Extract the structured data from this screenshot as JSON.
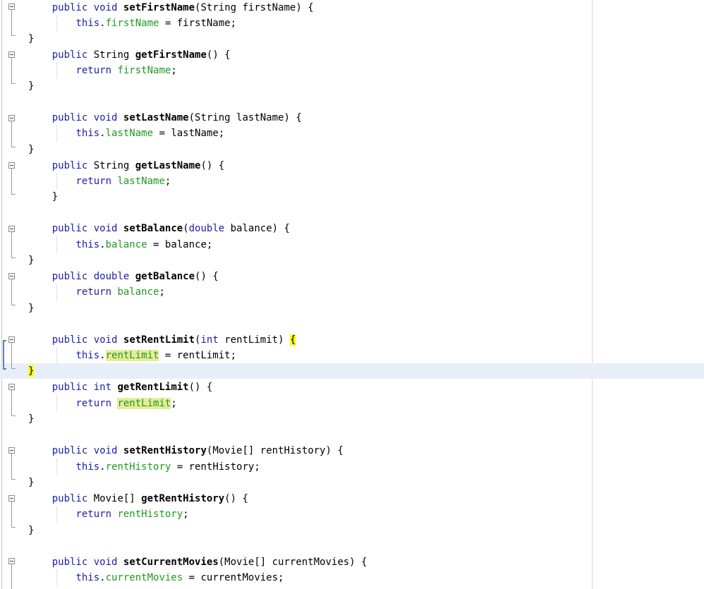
{
  "editor": {
    "lines": [
      {
        "id": "l1",
        "tokens": [
          {
            "t": "    "
          },
          {
            "t": "public",
            "c": "kw"
          },
          {
            "t": " "
          },
          {
            "t": "void",
            "c": "kw"
          },
          {
            "t": " "
          },
          {
            "t": "setFirstName",
            "c": "fn"
          },
          {
            "t": "(String firstName) {"
          }
        ]
      },
      {
        "id": "l2",
        "tokens": [
          {
            "t": "        "
          },
          {
            "t": "this",
            "c": "kw"
          },
          {
            "t": "."
          },
          {
            "t": "firstName",
            "c": "fld"
          },
          {
            "t": " = firstName;"
          }
        ]
      },
      {
        "id": "l3",
        "tokens": [
          {
            "t": "}"
          }
        ]
      },
      {
        "id": "l4",
        "tokens": [
          {
            "t": "    "
          },
          {
            "t": "public",
            "c": "kw"
          },
          {
            "t": " String "
          },
          {
            "t": "getFirstName",
            "c": "fn"
          },
          {
            "t": "() {"
          }
        ]
      },
      {
        "id": "l5",
        "tokens": [
          {
            "t": "        "
          },
          {
            "t": "return",
            "c": "kw"
          },
          {
            "t": " "
          },
          {
            "t": "firstName",
            "c": "fld"
          },
          {
            "t": ";"
          }
        ]
      },
      {
        "id": "l6",
        "tokens": [
          {
            "t": "}"
          }
        ]
      },
      {
        "id": "l7",
        "tokens": [
          {
            "t": "    "
          },
          {
            "t": "public",
            "c": "kw"
          },
          {
            "t": " "
          },
          {
            "t": "void",
            "c": "kw"
          },
          {
            "t": " "
          },
          {
            "t": "setLastName",
            "c": "fn"
          },
          {
            "t": "(String lastName) {"
          }
        ]
      },
      {
        "id": "l8",
        "tokens": [
          {
            "t": "        "
          },
          {
            "t": "this",
            "c": "kw"
          },
          {
            "t": "."
          },
          {
            "t": "lastName",
            "c": "fld"
          },
          {
            "t": " = lastName;"
          }
        ]
      },
      {
        "id": "l9",
        "tokens": [
          {
            "t": "}"
          }
        ]
      },
      {
        "id": "l10",
        "tokens": [
          {
            "t": "    "
          },
          {
            "t": "public",
            "c": "kw"
          },
          {
            "t": " String "
          },
          {
            "t": "getLastName",
            "c": "fn"
          },
          {
            "t": "() {"
          }
        ]
      },
      {
        "id": "l11",
        "tokens": [
          {
            "t": "        "
          },
          {
            "t": "return",
            "c": "kw"
          },
          {
            "t": " "
          },
          {
            "t": "lastName",
            "c": "fld"
          },
          {
            "t": ";"
          }
        ]
      },
      {
        "id": "l12",
        "tokens": [
          {
            "t": "    }"
          }
        ]
      },
      {
        "id": "l13",
        "tokens": [
          {
            "t": "    "
          },
          {
            "t": "public",
            "c": "kw"
          },
          {
            "t": " "
          },
          {
            "t": "void",
            "c": "kw"
          },
          {
            "t": " "
          },
          {
            "t": "setBalance",
            "c": "fn"
          },
          {
            "t": "("
          },
          {
            "t": "double",
            "c": "kw"
          },
          {
            "t": " balance) {"
          }
        ]
      },
      {
        "id": "l14",
        "tokens": [
          {
            "t": "        "
          },
          {
            "t": "this",
            "c": "kw"
          },
          {
            "t": "."
          },
          {
            "t": "balance",
            "c": "fld"
          },
          {
            "t": " = balance;"
          }
        ]
      },
      {
        "id": "l15",
        "tokens": [
          {
            "t": "}"
          }
        ]
      },
      {
        "id": "l16",
        "tokens": [
          {
            "t": "    "
          },
          {
            "t": "public",
            "c": "kw"
          },
          {
            "t": " "
          },
          {
            "t": "double",
            "c": "kw"
          },
          {
            "t": " "
          },
          {
            "t": "getBalance",
            "c": "fn"
          },
          {
            "t": "() {"
          }
        ]
      },
      {
        "id": "l17",
        "tokens": [
          {
            "t": "        "
          },
          {
            "t": "return",
            "c": "kw"
          },
          {
            "t": " "
          },
          {
            "t": "balance",
            "c": "fld"
          },
          {
            "t": ";"
          }
        ]
      },
      {
        "id": "l18",
        "tokens": [
          {
            "t": "}"
          }
        ]
      },
      {
        "id": "l19",
        "tokens": [
          {
            "t": "    "
          },
          {
            "t": "public",
            "c": "kw"
          },
          {
            "t": " "
          },
          {
            "t": "void",
            "c": "kw"
          },
          {
            "t": " "
          },
          {
            "t": "setRentLimit",
            "c": "fn"
          },
          {
            "t": "("
          },
          {
            "t": "int",
            "c": "kw"
          },
          {
            "t": " rentLimit) "
          },
          {
            "t": "{",
            "c": "hl-brace"
          }
        ]
      },
      {
        "id": "l20",
        "tokens": [
          {
            "t": "        "
          },
          {
            "t": "this",
            "c": "kw"
          },
          {
            "t": "."
          },
          {
            "t": "rentLimit",
            "c": "fld hl-word"
          },
          {
            "t": " = rentLimit;"
          }
        ]
      },
      {
        "id": "l21",
        "tokens": [
          {
            "t": "}",
            "c": "hl-brace"
          }
        ]
      },
      {
        "id": "l22",
        "tokens": [
          {
            "t": "    "
          },
          {
            "t": "public",
            "c": "kw"
          },
          {
            "t": " "
          },
          {
            "t": "int",
            "c": "kw"
          },
          {
            "t": " "
          },
          {
            "t": "getRentLimit",
            "c": "fn"
          },
          {
            "t": "() {"
          }
        ]
      },
      {
        "id": "l23",
        "tokens": [
          {
            "t": "        "
          },
          {
            "t": "return",
            "c": "kw"
          },
          {
            "t": " "
          },
          {
            "t": "rentLimit",
            "c": "fld hl-word"
          },
          {
            "t": ";"
          }
        ]
      },
      {
        "id": "l24",
        "tokens": [
          {
            "t": "}"
          }
        ]
      },
      {
        "id": "l25",
        "tokens": [
          {
            "t": "    "
          },
          {
            "t": "public",
            "c": "kw"
          },
          {
            "t": " "
          },
          {
            "t": "void",
            "c": "kw"
          },
          {
            "t": " "
          },
          {
            "t": "setRentHistory",
            "c": "fn"
          },
          {
            "t": "(Movie[] rentHistory) {"
          }
        ]
      },
      {
        "id": "l26",
        "tokens": [
          {
            "t": "        "
          },
          {
            "t": "this",
            "c": "kw"
          },
          {
            "t": "."
          },
          {
            "t": "rentHistory",
            "c": "fld"
          },
          {
            "t": " = rentHistory;"
          }
        ]
      },
      {
        "id": "l27",
        "tokens": [
          {
            "t": "}"
          }
        ]
      },
      {
        "id": "l28",
        "tokens": [
          {
            "t": "    "
          },
          {
            "t": "public",
            "c": "kw"
          },
          {
            "t": " Movie[] "
          },
          {
            "t": "getRentHistory",
            "c": "fn"
          },
          {
            "t": "() {"
          }
        ]
      },
      {
        "id": "l29",
        "tokens": [
          {
            "t": "        "
          },
          {
            "t": "return",
            "c": "kw"
          },
          {
            "t": " "
          },
          {
            "t": "rentHistory",
            "c": "fld"
          },
          {
            "t": ";"
          }
        ]
      },
      {
        "id": "l30",
        "tokens": [
          {
            "t": "}"
          }
        ]
      },
      {
        "id": "l31",
        "tokens": [
          {
            "t": "    "
          },
          {
            "t": "public",
            "c": "kw"
          },
          {
            "t": " "
          },
          {
            "t": "void",
            "c": "kw"
          },
          {
            "t": " "
          },
          {
            "t": "setCurrentMovies",
            "c": "fn"
          },
          {
            "t": "(Movie[] currentMovies) {"
          }
        ]
      },
      {
        "id": "l32",
        "tokens": [
          {
            "t": "        "
          },
          {
            "t": "this",
            "c": "kw"
          },
          {
            "t": "."
          },
          {
            "t": "currentMovies",
            "c": "fld"
          },
          {
            "t": " = currentMovies;"
          }
        ]
      }
    ]
  }
}
